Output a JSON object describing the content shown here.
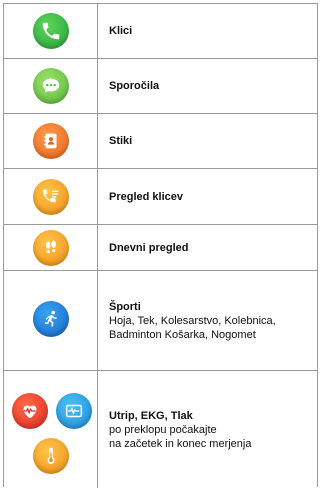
{
  "rows": [
    {
      "label": "Klici",
      "icon": "phone-icon",
      "color": "#2ea84a"
    },
    {
      "label": "Sporočila",
      "icon": "message-icon",
      "color": "#6cc44a"
    },
    {
      "label": "Stiki",
      "icon": "contacts-icon",
      "color": "#ef6a24"
    },
    {
      "label": "Pregled klicev",
      "icon": "call-log-icon",
      "color": "#f59a1c"
    },
    {
      "label": "Dnevni pregled",
      "icon": "footsteps-icon",
      "color": "#f5a31c"
    },
    {
      "label": "Športi",
      "description_line1": "Hoja, Tek, Kolesarstvo, Kolebnica,",
      "description_line2": "Badminton Košarka, Nogomet",
      "icon": "running-icon",
      "color": "#1c78d4"
    },
    {
      "label": "Utrip, EKG, Tlak",
      "description_line1": "po preklopu počakajte",
      "description_line2": "na začetek in konec merjenja",
      "icons": [
        "heart-rate-icon",
        "ecg-icon",
        "thermometer-icon"
      ],
      "colors": [
        "#e8341f",
        "#2a9be8",
        "#f2891a"
      ]
    }
  ]
}
